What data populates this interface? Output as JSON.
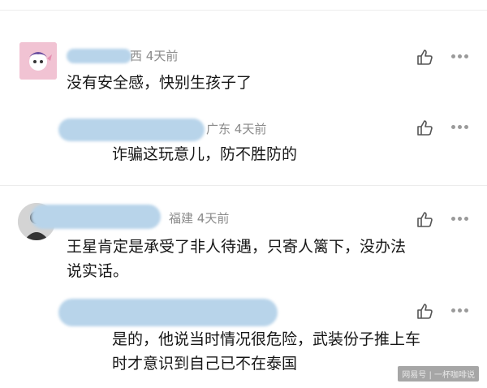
{
  "comments": [
    {
      "location": "西",
      "time": "4天前",
      "text": "没有安全感，快别生孩子了",
      "reply": {
        "location": "广东",
        "time": "4天前",
        "text": "诈骗这玩意儿，防不胜防的"
      }
    },
    {
      "location": "福建",
      "time": "4天前",
      "text_line1": "王星肯定是承受了非人待遇，只寄人篱下，没办法",
      "text_line2": "说实话。",
      "reply": {
        "text_line1": "是的，他说当时情况很危险，武装份子推上车",
        "text_line2": "时才意识到自己已不在泰国"
      }
    }
  ],
  "watermark": "网易号 | 一杯咖啡说"
}
